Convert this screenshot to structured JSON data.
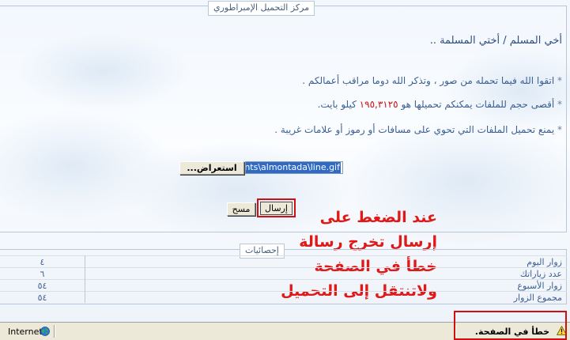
{
  "upload_form": {
    "legend": "مركز التحميل الإمبراطوري",
    "greeting": "أخي المسلم / أختي المسلمة ..",
    "rules": [
      {
        "bullet": "*",
        "text": "اتقوا الله فيما تحمله من صور ، وتذكر الله دوما مراقب أعمالكم ."
      },
      {
        "bullet": "*",
        "text_before": "أقصى حجم للملفات يمكنكم تحميلها هو",
        "size": "١٩٥,٣١٢٥",
        "text_after": "كيلو بايت."
      },
      {
        "bullet": "*",
        "text": "يمنع تحميل الملفات التي تحوي على مسافات أو رموز أو علامات غريبة ."
      }
    ],
    "file_input_value": "nts\\almontada\\line.gif",
    "browse_label": "استعراض...",
    "send_label": "إرسال",
    "clear_label": "مسح"
  },
  "annotation": {
    "lines": [
      "عند الضغط على",
      "إرسال تخرج رسالة",
      "خطأ في الصفحة",
      "ولاتنتقل إلى التحميل"
    ],
    "color": "#e01818"
  },
  "stats": {
    "legend": "إحصائيات",
    "rows": [
      {
        "label": "زوار اليوم",
        "value": "٤"
      },
      {
        "label": "عدد زياراتك",
        "value": "٦"
      },
      {
        "label": "زوار الأسبوع",
        "value": "٥٤"
      },
      {
        "label": "مجموع الزوار",
        "value": "٥٤"
      }
    ]
  },
  "status_bar": {
    "zone": "Internet",
    "zone_icon": "globe-icon",
    "error_text": "خطأ في الصفحة.",
    "error_icon": "warning-icon"
  },
  "colors": {
    "text_blue": "#3d5f91",
    "highlight_red": "#d01010",
    "size_red": "#cc1111"
  }
}
